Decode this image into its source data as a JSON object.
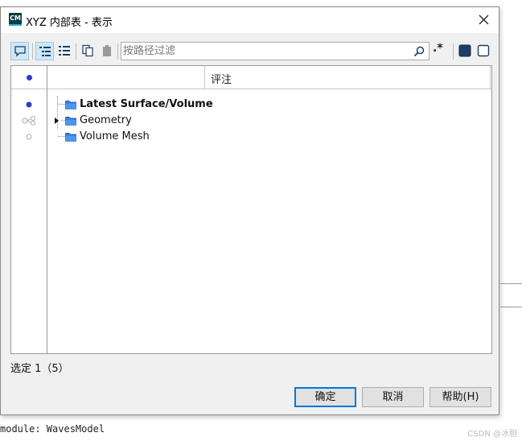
{
  "window": {
    "title": "XYZ 内部表 - 表示",
    "logo_text": "CM"
  },
  "toolbar": {
    "filter_placeholder": "按路径过滤",
    "regex_label": ".*"
  },
  "table": {
    "column_comment": "评注",
    "rows": [
      {
        "label": "Latest Surface/Volume",
        "bold": true,
        "marker": "filled-dot",
        "expandable": false
      },
      {
        "label": "Geometry",
        "bold": false,
        "marker": "linked-circles",
        "expandable": true
      },
      {
        "label": "Volume Mesh",
        "bold": false,
        "marker": "hollow-dot",
        "expandable": false
      }
    ]
  },
  "status": {
    "text": "选定 1（5）"
  },
  "buttons": {
    "ok": "确定",
    "cancel": "取消",
    "help": "帮助(H)"
  },
  "background": {
    "code_line": "module: WavesModel",
    "watermark": "CSDN @冰胆"
  },
  "colors": {
    "accent": "#0078d7",
    "selected_dot": "#2b3bd1",
    "folder": "#2f7ae5"
  }
}
